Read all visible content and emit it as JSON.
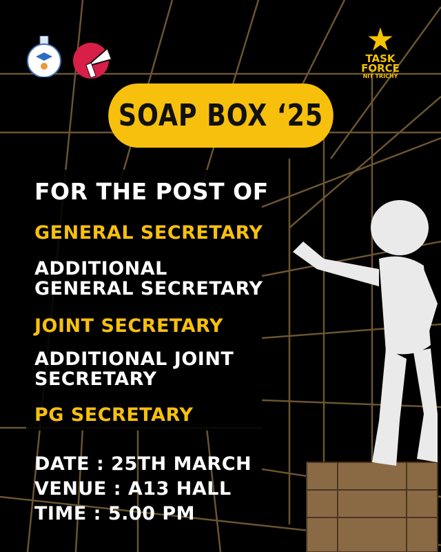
{
  "title": "SOAP BOX ‘25",
  "logos": {
    "left_1": "institute-emblem",
    "left_2": "megaphone-logo",
    "right": {
      "line1": "TASK",
      "line2": "FORCE",
      "line3": "NIT TRICHY"
    }
  },
  "heading": "FOR THE POST OF",
  "posts": [
    "GENERAL SECRETARY",
    "ADDITIONAL GENERAL SECRETARY",
    "JOINT SECRETARY",
    "ADDITIONAL JOINT SECRETARY",
    "PG SECRETARY"
  ],
  "details": {
    "date": "DATE : 25TH MARCH",
    "venue": "VENUE : A13 HALL",
    "time": "TIME : 5.00 PM"
  },
  "colors": {
    "accent": "#f7c00d",
    "grid": "#6b5530",
    "background": "#000000"
  }
}
